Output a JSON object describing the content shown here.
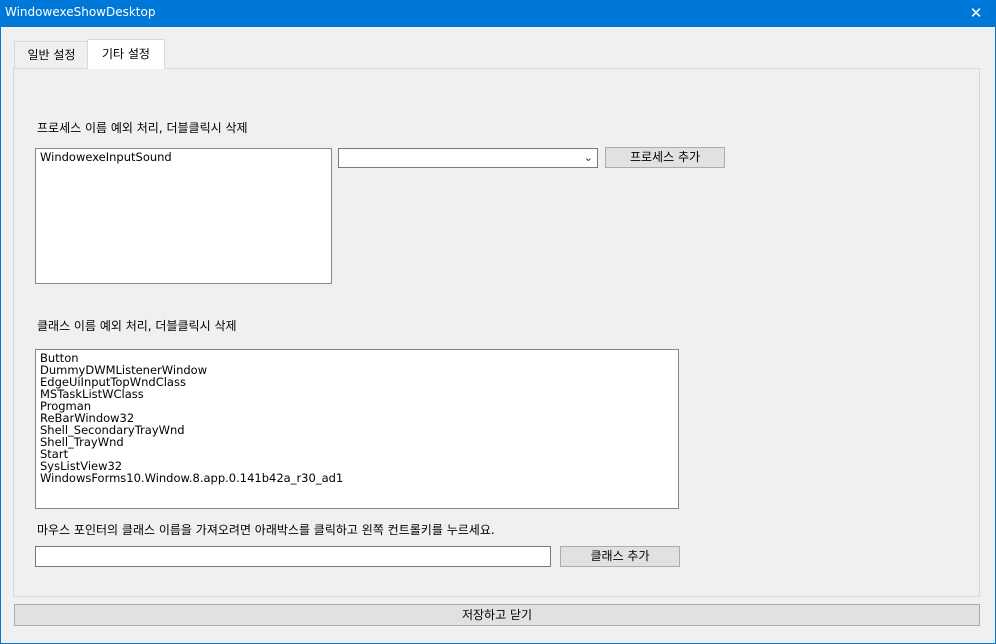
{
  "window": {
    "title": "WindowexeShowDesktop",
    "close_glyph": "✕"
  },
  "tabs": [
    {
      "label": "일반 설정"
    },
    {
      "label": "기타 설정"
    }
  ],
  "process_section": {
    "label": "프로세스 이름 예외 처리, 더블클릭시 삭제",
    "items": [
      "WindowexeInputSound"
    ],
    "combo_value": "",
    "add_button": "프로세스 추가"
  },
  "class_section": {
    "label": "클래스 이름 예외 처리, 더블클릭시 삭제",
    "items": [
      "Button",
      "DummyDWMListenerWindow",
      "EdgeUiInputTopWndClass",
      "MSTaskListWClass",
      "Progman",
      "ReBarWindow32",
      "Shell_SecondaryTrayWnd",
      "Shell_TrayWnd",
      "Start",
      "SysListView32",
      "WindowsForms10.Window.8.app.0.141b42a_r30_ad1"
    ],
    "hint": "마우스 포인터의 클래스 이름을 가져오려면 아래박스를 클릭하고 왼쪽 컨트롤키를 누르세요.",
    "input_value": "",
    "add_button": "클래스 추가"
  },
  "footer": {
    "save_button": "저장하고 닫기"
  },
  "colors": {
    "titlebar": "#0078d7",
    "window_bg": "#f0f0f0"
  }
}
